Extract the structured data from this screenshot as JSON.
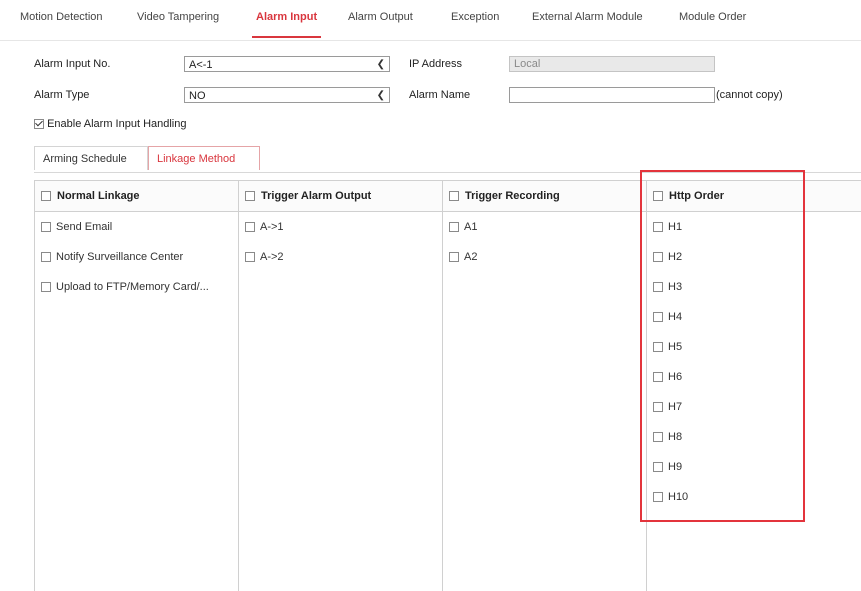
{
  "top_tabs": [
    {
      "label": "Motion Detection"
    },
    {
      "label": "Video Tampering"
    },
    {
      "label": "Alarm Input"
    },
    {
      "label": "Alarm Output"
    },
    {
      "label": "Exception"
    },
    {
      "label": "External Alarm Module"
    },
    {
      "label": "Module Order"
    }
  ],
  "form": {
    "alarm_input_no_label": "Alarm Input No.",
    "alarm_input_no_value": "A<-1",
    "ip_address_label": "IP Address",
    "ip_address_value": "Local",
    "alarm_type_label": "Alarm Type",
    "alarm_type_value": "NO",
    "alarm_name_label": "Alarm Name",
    "alarm_name_value": "",
    "cannot_copy_note": "(cannot copy)",
    "enable_label": "Enable Alarm Input Handling",
    "enable_checked": true
  },
  "sub_tabs": [
    {
      "label": "Arming Schedule"
    },
    {
      "label": "Linkage Method"
    }
  ],
  "columns": {
    "normal": {
      "header": "Normal Linkage",
      "items": [
        "Send Email",
        "Notify Surveillance Center",
        "Upload to FTP/Memory Card/..."
      ]
    },
    "trigger_output": {
      "header": "Trigger Alarm Output",
      "items": [
        "A->1",
        "A->2"
      ]
    },
    "trigger_recording": {
      "header": "Trigger Recording",
      "items": [
        "A1",
        "A2"
      ]
    },
    "http_order": {
      "header": "Http Order",
      "items": [
        "H1",
        "H2",
        "H3",
        "H4",
        "H5",
        "H6",
        "H7",
        "H8",
        "H9",
        "H10"
      ]
    }
  },
  "colors": {
    "accent": "#d9363e",
    "highlight": "#e3343c"
  }
}
